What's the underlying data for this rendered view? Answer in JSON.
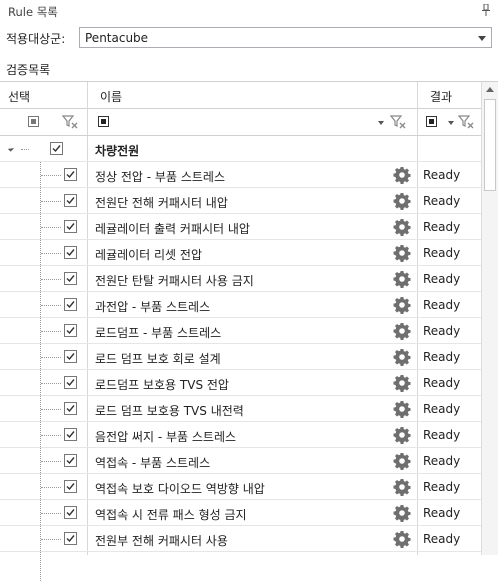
{
  "panel": {
    "title": "Rule 목록",
    "pin_icon": "pin-icon"
  },
  "target": {
    "label": "적용대상군:",
    "value": "Pentacube"
  },
  "section": {
    "label": "검증목록"
  },
  "columns": {
    "select": "선택",
    "name": "이름",
    "result": "결과"
  },
  "group": {
    "name": "차량전원",
    "checked": true
  },
  "rules": [
    {
      "name": "정상 전압 - 부품 스트레스",
      "result": "Ready",
      "checked": true
    },
    {
      "name": "전원단 전해 커패시터 내압",
      "result": "Ready",
      "checked": true
    },
    {
      "name": "레귤레이터 출력 커패시터 내압",
      "result": "Ready",
      "checked": true
    },
    {
      "name": "레귤레이터 리셋 전압",
      "result": "Ready",
      "checked": true
    },
    {
      "name": "전원단 탄탈 커패시터 사용 금지",
      "result": "Ready",
      "checked": true
    },
    {
      "name": "과전압 - 부품 스트레스",
      "result": "Ready",
      "checked": true
    },
    {
      "name": "로드덤프 - 부품 스트레스",
      "result": "Ready",
      "checked": true
    },
    {
      "name": "로드 덤프 보호 회로 설계",
      "result": "Ready",
      "checked": true
    },
    {
      "name": "로드덤프 보호용 TVS 전압",
      "result": "Ready",
      "checked": true
    },
    {
      "name": "로드 덤프 보호용 TVS 내전력",
      "result": "Ready",
      "checked": true
    },
    {
      "name": "음전압 써지 - 부품 스트레스",
      "result": "Ready",
      "checked": true
    },
    {
      "name": "역접속 - 부품 스트레스",
      "result": "Ready",
      "checked": true
    },
    {
      "name": "역접속 보호 다이오드 역방향 내압",
      "result": "Ready",
      "checked": true
    },
    {
      "name": "역접속 시 전류 패스 형성 금지",
      "result": "Ready",
      "checked": true
    },
    {
      "name": "전원부 전해 커패시터 사용",
      "result": "Ready",
      "checked": true
    }
  ]
}
